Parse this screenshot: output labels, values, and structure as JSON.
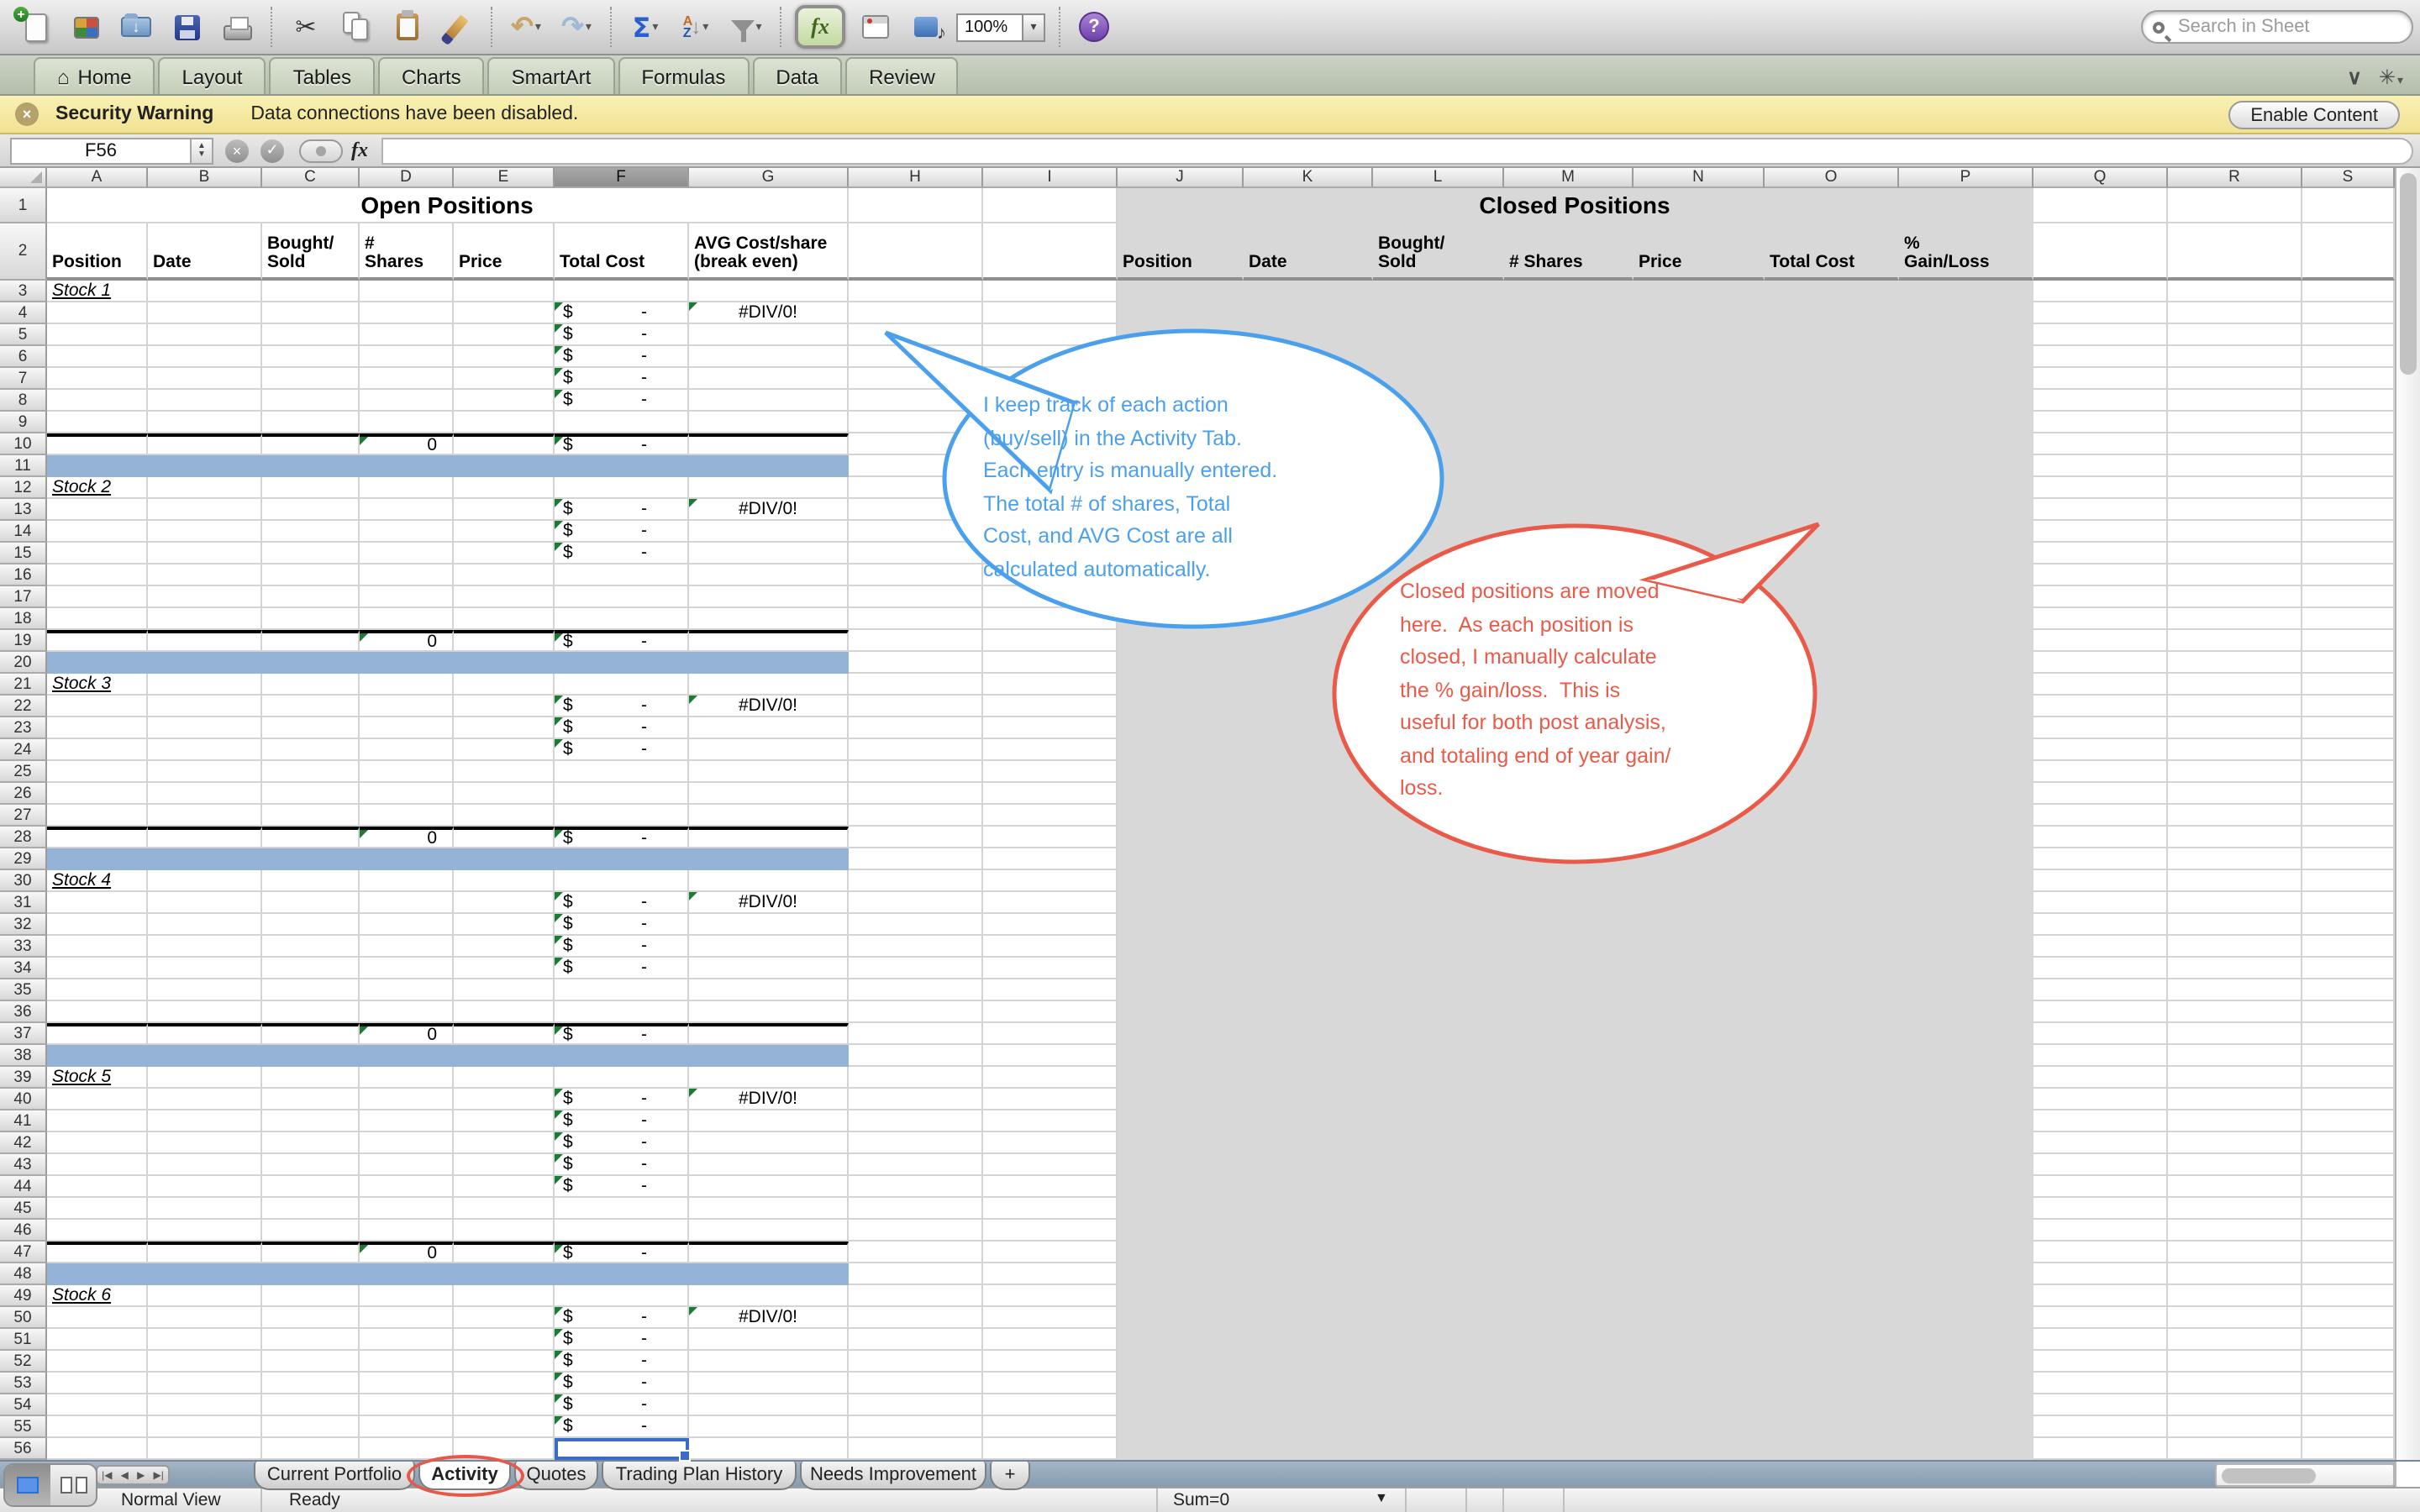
{
  "toolbar": {
    "zoom": "100%",
    "search_placeholder": "Search in Sheet"
  },
  "glyphs": {
    "home": "⌂",
    "cut": "✂",
    "undo": "↶",
    "redo": "↷",
    "sum": "Σ",
    "sort_a": "A",
    "sort_z": "Z",
    "sort_arrow": "↓",
    "help": "?",
    "chevron_down": "∨",
    "gear": "✳",
    "dropdown": "▾",
    "dropdown_big": "▼",
    "up": "▲",
    "down": "▼",
    "cancel": "×",
    "accept": "✓",
    "fx": "fx",
    "open_arrow": "↓",
    "nav_first": "|◀",
    "nav_prev": "◀",
    "nav_next": "▶",
    "nav_last": "▶|",
    "new_plus": "+"
  },
  "ribbon": {
    "tabs": [
      "Home",
      "Layout",
      "Tables",
      "Charts",
      "SmartArt",
      "Formulas",
      "Data",
      "Review"
    ]
  },
  "security": {
    "title": "Security Warning",
    "message": "Data connections have been disabled.",
    "button": "Enable Content"
  },
  "formula_bar": {
    "cell_ref": "F56",
    "fx_label": "fx"
  },
  "sheet": {
    "gutter_w": 28,
    "columns": [
      [
        "A",
        60
      ],
      [
        "B",
        68
      ],
      [
        "C",
        58
      ],
      [
        "D",
        56
      ],
      [
        "E",
        60
      ],
      [
        "F",
        80
      ],
      [
        "G",
        95
      ],
      [
        "H",
        80
      ],
      [
        "I",
        80
      ],
      [
        "J",
        75
      ],
      [
        "K",
        77
      ],
      [
        "L",
        78
      ],
      [
        "M",
        77
      ],
      [
        "N",
        78
      ],
      [
        "O",
        80
      ],
      [
        "P",
        80
      ],
      [
        "Q",
        80
      ],
      [
        "R",
        80
      ],
      [
        "S",
        55
      ]
    ],
    "open_title": "Open Positions",
    "closed_title": "Closed Positions",
    "open_headers": {
      "A": "Position",
      "B": "Date",
      "C": "Bought/\nSold",
      "D": "#\nShares",
      "E": "Price",
      "F": "Total Cost",
      "G": "AVG Cost/share\n(break even)"
    },
    "closed_headers": {
      "J": "Position",
      "K": "Date",
      "L": "Bought/\nSold",
      "M": "# Shares",
      "N": "Price",
      "O": "Total Cost",
      "P": "%\nGain/Loss"
    },
    "stocks": [
      [
        3,
        "Stock 1"
      ],
      [
        12,
        "Stock 2"
      ],
      [
        21,
        "Stock 3"
      ],
      [
        30,
        "Stock 4"
      ],
      [
        39,
        "Stock 5"
      ],
      [
        49,
        "Stock 6"
      ]
    ],
    "money_rows": [
      4,
      5,
      6,
      7,
      8,
      13,
      14,
      15,
      22,
      23,
      24,
      31,
      32,
      33,
      34,
      40,
      41,
      42,
      43,
      44,
      50,
      51,
      52,
      53,
      54,
      55
    ],
    "error_rows": [
      4,
      13,
      22,
      31,
      40,
      50
    ],
    "total_rows": [
      10,
      19,
      28,
      37,
      47
    ],
    "blue_rows": [
      11,
      20,
      29,
      38,
      48
    ],
    "num_rows": 56,
    "currency": "$",
    "dash": "-",
    "zero": "0",
    "error_text": "#DIV/0!",
    "selected_cell": "F56",
    "blue_fill": "#95b3d7",
    "gray_fill": "#d8d8d8"
  },
  "bubbles": {
    "blue": {
      "color": "#4ba0ee",
      "text": "I keep track of each action\n(buy/sell) in the Activity Tab.\nEach entry is manually entered.\nThe total # of shares, Total\nCost, and AVG Cost are all\ncalculated automatically."
    },
    "red": {
      "color": "#ea5a49",
      "text": "Closed positions are moved\nhere.  As each position is\nclosed, I manually calculate\nthe % gain/loss.  This is\nuseful for both post analysis,\nand totaling end of year gain/\nloss."
    }
  },
  "sheet_tabs": {
    "tabs": [
      "Current Portfolio",
      "Activity",
      "Quotes",
      "Trading Plan History",
      "Needs Improvement"
    ],
    "active": "Activity",
    "add_label": "+"
  },
  "status_bar": {
    "view_label": "Normal View",
    "state": "Ready",
    "sum_label": "Sum=0"
  }
}
